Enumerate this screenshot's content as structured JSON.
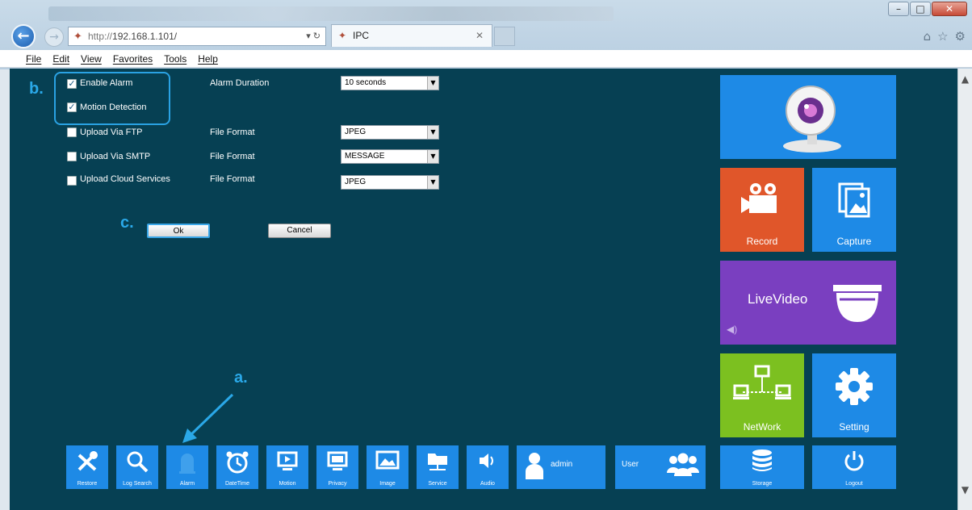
{
  "browser": {
    "url_prefix": "http://",
    "url_host": "192.168.1.101/",
    "tab_title": "IPC",
    "menu": [
      "File",
      "Edit",
      "View",
      "Favorites",
      "Tools",
      "Help"
    ]
  },
  "settings": {
    "enable_alarm": {
      "label": "Enable Alarm",
      "checked": true
    },
    "motion_detection": {
      "label": "Motion Detection",
      "checked": true
    },
    "alarm_duration": {
      "label": "Alarm Duration",
      "value": "10 seconds"
    },
    "upload_ftp": {
      "label": "Upload Via FTP",
      "format_label": "File Format",
      "format_value": "JPEG"
    },
    "upload_smtp": {
      "label": "Upload Via SMTP",
      "format_label": "File Format",
      "format_value": "MESSAGE"
    },
    "upload_cloud": {
      "label": "Upload Cloud Services",
      "format_label": "File Format",
      "format_value": "JPEG"
    },
    "ok_label": "Ok",
    "cancel_label": "Cancel"
  },
  "markers": {
    "a": "a.",
    "b": "b.",
    "c": "c."
  },
  "tiles": {
    "record": "Record",
    "capture": "Capture",
    "live_video": "LiveVideo",
    "network": "NetWork",
    "setting": "Setting",
    "storage": "Storage",
    "logout": "Logout"
  },
  "toolbar": {
    "restore": "Restore",
    "log_search": "Log Search",
    "alarm": "Alarm",
    "datetime": "DateTime",
    "motion": "Motion",
    "privacy": "Privacy",
    "image": "Image",
    "service": "Service",
    "audio": "Audio",
    "admin": "admin",
    "user": "User"
  },
  "colors": {
    "page_bg": "#064053",
    "tile_blue": "#1e8ae6",
    "tile_record": "#e0562a",
    "tile_live": "#7a3fc0",
    "tile_network": "#7cc020",
    "highlight": "#2aa8e8"
  }
}
